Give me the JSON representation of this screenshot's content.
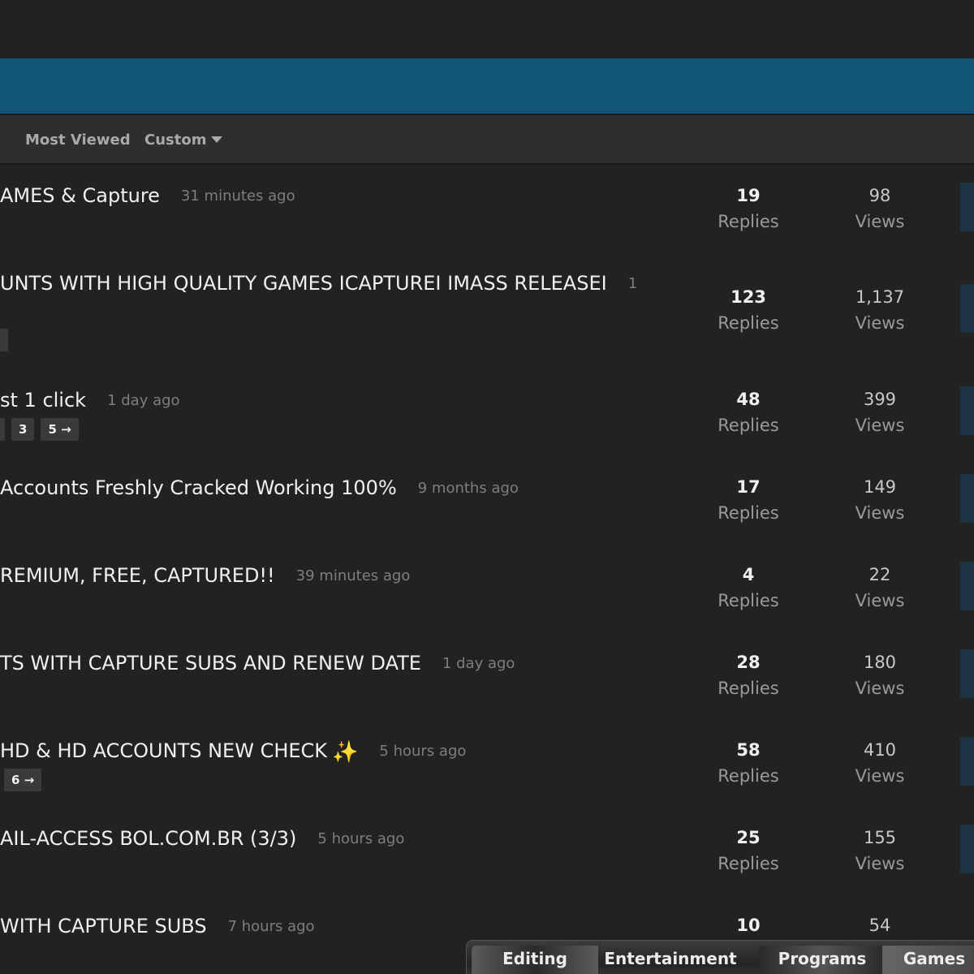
{
  "filters": {
    "most_viewed": "Most Viewed",
    "custom": "Custom"
  },
  "threads": [
    {
      "title": "AMES & Capture",
      "time": "31 minutes ago",
      "replies": "19",
      "views": "98",
      "pages": []
    },
    {
      "title": "UNTS WITH HIGH QUALITY GAMES ICAPTUREI IMASS RELEASEI",
      "time": "1",
      "replies": "123",
      "views": "1,137",
      "pages": []
    },
    {
      "title": "st 1 click",
      "time": "1 day ago",
      "replies": "48",
      "views": "399",
      "pages": [
        "3",
        "5 →"
      ]
    },
    {
      "title": "Accounts Freshly Cracked Working 100%",
      "time": "9 months ago",
      "replies": "17",
      "views": "149",
      "pages": []
    },
    {
      "title": "REMIUM, FREE, CAPTURED!!",
      "time": "39 minutes ago",
      "replies": "4",
      "views": "22",
      "pages": []
    },
    {
      "title": "TS WITH CAPTURE SUBS AND RENEW DATE",
      "time": "1 day ago",
      "replies": "28",
      "views": "180",
      "pages": []
    },
    {
      "title": "HD & HD ACCOUNTS NEW CHECK",
      "time": "5 hours ago",
      "replies": "58",
      "views": "410",
      "pages": [
        "6 →"
      ]
    },
    {
      "title": "AIL-ACCESS BOL.COM.BR (3/3)",
      "time": "5 hours ago",
      "replies": "25",
      "views": "155",
      "pages": []
    },
    {
      "title": "WITH CAPTURE SUBS",
      "time": "7 hours ago",
      "replies": "10",
      "views": "54",
      "pages": []
    }
  ],
  "labels": {
    "replies": "Replies",
    "views": "Views"
  },
  "tabs": [
    "Editing",
    "Entertainment",
    "Programs",
    "Games"
  ],
  "icons": {
    "sparkle": "sparkle-icon",
    "caret": "chevron-down-icon"
  },
  "colors": {
    "banner": "#115577",
    "background": "#222222"
  }
}
